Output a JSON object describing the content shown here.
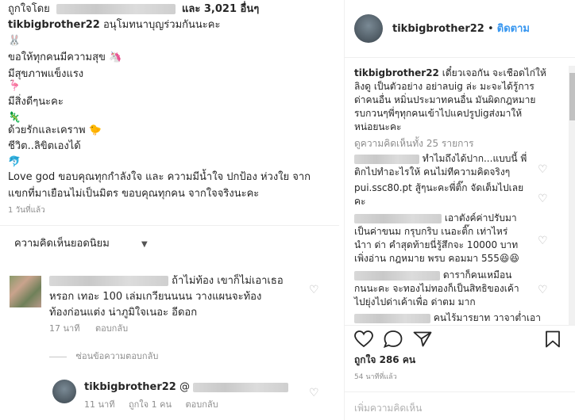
{
  "left": {
    "liked_by_prefix": "ถูกใจโดย",
    "liked_by_suffix": "และ 3,021 อื่นๆ",
    "caption_user": "tikbigbrother22",
    "caption_first": "อนุโมทนาบุญร่วมกันนะคะ",
    "caption_lines": [
      "🐰",
      "ขอให้ทุกคนมีความสุข 🦄",
      "มีสุขภาพแข็งแรง",
      "🦩",
      "มีสิ่งดีๆนะคะ",
      "🦎",
      "ด้วยรักและเคราพ 🐤",
      "ชีวิต..ลิขิตเองได้",
      "🐬",
      "Love god ขอบคุณทุกกำลังใจ และ ความมีน้ำใจ ปกป้อง ห่วงใย จาก",
      "แขกที่มาเยือนไม่เป็นมิตร ขอบคุณทุกคน จากใจจริงนะคะ"
    ],
    "time_ago": "1 วันที่แล้ว",
    "top_comments_label": "ความคิดเห็นยอดนิยม",
    "comment1": {
      "line1": "ถ้าไม่ท้อง เขาก็ไม่เอาเธอ",
      "line2": "หรอก เทอะ 100 เล่มเกวียนนนน วางแผนจะท้อง",
      "line3": "ท้องก่อนแต่ง น่าภูมิใจเนอะ อีดอก",
      "time": "17 นาที",
      "reply": "ตอบกลับ"
    },
    "hide_replies": "ซ่อนข้อความตอบกลับ",
    "reply1": {
      "user": "tikbigbrother22",
      "mention": "@",
      "time": "11 นาที",
      "likes": "ถูกใจ 1 คน",
      "reply": "ตอบกลับ"
    }
  },
  "right": {
    "header_user": "tikbigbrother22",
    "follow": "ติดตาม",
    "caption_user": "tikbigbrother22",
    "caption_lines": [
      "เดี๋ยวเจอกัน จะเชือดไก่ให้",
      "ลิงดู เป็นตัวอย่าง อย่าลบig ล่ะ มะจะได้รู้การ",
      "ด่าคนอื่น หมิ่นประมาทคนอื่น มันผิดกฎหมาย",
      "รบกวนๆพี่ๆทุกคนเข้าไปแคปรูปigส่งมาให้",
      "หน่อยนะคะ"
    ],
    "view_all": "ดูความคิดเห็นทั้ง 25 รายการ",
    "comments": [
      [
        "ทำไมถึงได้ปาก...แบบนี้ พี่",
        "ติกไปทำอะไรให้ คนไม่ทีความคิดจริงๆ"
      ],
      [
        "pui.ssc80.pt สู้ๆนะคะพี่ติ๊ก จัดเต็มไปเลย",
        "คะ"
      ],
      [
        "เอาตังค์ค่าปรับมา",
        "เป็นค่าขนม กรุบกริบ เนอะติ๊ก เท่าไหร่",
        "นำา ด่า คำสุดท้ายนี่รู้สึกจะ 10000 บาท",
        "เพิ่งอ่าน กฎหมาย พรบ คอมมา 555😆😆"
      ],
      [
        "ดาราก็คนเหมือน",
        "กนนะคะ จะทองไม่ทองก็เป็นสิทธิของเค้า",
        "ไปยุ่งไปด่าเค้าเพื่อ ด่าตม มาก"
      ],
      [
        "คนไร้มารยาท วาจาต่ำเอา"
      ]
    ],
    "likes": "ถูกใจ 286 คน",
    "time_ago": "54 นาทีที่แล้ว",
    "add_comment": "เพิ่มความคิดเห็น"
  }
}
